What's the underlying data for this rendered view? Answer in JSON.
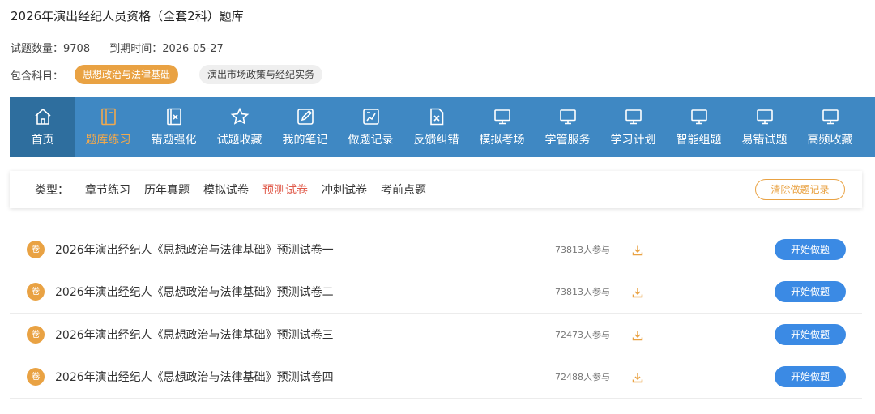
{
  "page": {
    "title": "2026年演出经纪人员资格（全套2科）题库"
  },
  "meta": {
    "question_count": "试题数量：9708",
    "expire": "到期时间：2026-05-27"
  },
  "subjects": {
    "label": "包含科目：",
    "items": [
      {
        "label": "思想政治与法律基础",
        "active": true
      },
      {
        "label": "演出市场政策与经纪实务",
        "active": false
      }
    ]
  },
  "nav": {
    "items": [
      {
        "label": "首页",
        "icon": "home-icon"
      },
      {
        "label": "题库练习",
        "icon": "book-icon"
      },
      {
        "label": "错题强化",
        "icon": "wrong-book-icon"
      },
      {
        "label": "试题收藏",
        "icon": "star-icon"
      },
      {
        "label": "我的笔记",
        "icon": "note-edit-icon"
      },
      {
        "label": "做题记录",
        "icon": "record-icon"
      },
      {
        "label": "反馈纠错",
        "icon": "feedback-icon"
      },
      {
        "label": "模拟考场",
        "icon": "monitor-icon"
      },
      {
        "label": "学管服务",
        "icon": "monitor-icon"
      },
      {
        "label": "学习计划",
        "icon": "monitor-icon"
      },
      {
        "label": "智能组题",
        "icon": "monitor-icon"
      },
      {
        "label": "易错试题",
        "icon": "monitor-icon"
      },
      {
        "label": "高频收藏",
        "icon": "monitor-icon"
      }
    ]
  },
  "filter": {
    "label": "类型：",
    "options": [
      "章节练习",
      "历年真题",
      "模拟试卷",
      "预测试卷",
      "冲刺试卷",
      "考前点题"
    ],
    "clear_label": "清除做题记录"
  },
  "papers": [
    {
      "badge": "卷",
      "title": "2026年演出经纪人《思想政治与法律基础》预测试卷一",
      "count": "73813人参与",
      "action": "开始做题"
    },
    {
      "badge": "卷",
      "title": "2026年演出经纪人《思想政治与法律基础》预测试卷二",
      "count": "73813人参与",
      "action": "开始做题"
    },
    {
      "badge": "卷",
      "title": "2026年演出经纪人《思想政治与法律基础》预测试卷三",
      "count": "72473人参与",
      "action": "开始做题"
    },
    {
      "badge": "卷",
      "title": "2026年演出经纪人《思想政治与法律基础》预测试卷四",
      "count": "72488人参与",
      "action": "开始做题"
    }
  ],
  "colors": {
    "accent_orange": "#e9a243",
    "nav_blue": "#3f88c3",
    "nav_home_blue": "#2e6e9e",
    "button_blue": "#3b8ae4",
    "active_filter_red": "#e05a4a"
  }
}
